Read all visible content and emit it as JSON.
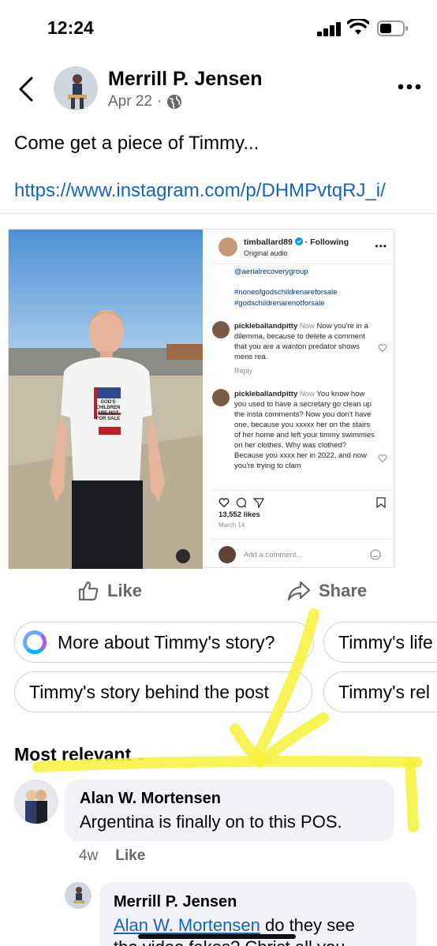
{
  "status_bar": {
    "time": "12:24"
  },
  "post": {
    "author": "Merrill P. Jensen",
    "date": "Apr 22",
    "separator": "·",
    "text": "Come get a piece of Timmy...",
    "link": "https://www.instagram.com/p/DHMPvtqRJ_i/"
  },
  "embed": {
    "shirt_text": "GOD'S CHILDREN ARE NOT FOR SALE",
    "ig": {
      "username": "timballard89",
      "follow": "Following",
      "audio": "Original audio",
      "mention": "@aerialrecoverygroup",
      "hashtag1": "#noneofgodschildrenareforsale",
      "hashtag2": "#godschildrenarenotforsale",
      "comments": [
        {
          "user": "pickleballandpitty",
          "time": "Now",
          "text": "Now you're in a dilemma, because to delete a comment that you are a wanton predator shows mens rea.",
          "reply": "Reply"
        },
        {
          "user": "pickleballandpitty",
          "time": "Now",
          "text": "You know how you used to have a secretary go clean up the insta comments? Now you don't have one, because you xxxxx her on the stairs of her home and left your timmy swimmies on her clothes. Why was clothed? Because you xxxx her in 2022, and now you're trying to clam"
        }
      ],
      "likes": "13,552 likes",
      "date": "March 14",
      "add_comment": "Add a comment..."
    }
  },
  "actions": {
    "like": "Like",
    "share": "Share"
  },
  "chips": [
    {
      "label": "More about Timmy's story?"
    },
    {
      "label": "Timmy's life"
    },
    {
      "label": "Timmy's story behind the post"
    },
    {
      "label": "Timmy's rel"
    }
  ],
  "sort": {
    "label": "Most relevant"
  },
  "comments": [
    {
      "author": "Alan W. Mortensen",
      "text": "Argentina is finally on to this POS.",
      "age": "4w",
      "like": "Like"
    },
    {
      "author": "Merrill P. Jensen",
      "mention": "Alan W. Mortensen",
      "text": " do they see",
      "text2": "the video fakes? Christ all you"
    }
  ],
  "colors": {
    "link": "#1565c0",
    "highlight": "#f6f23a",
    "muted": "#65676b"
  }
}
